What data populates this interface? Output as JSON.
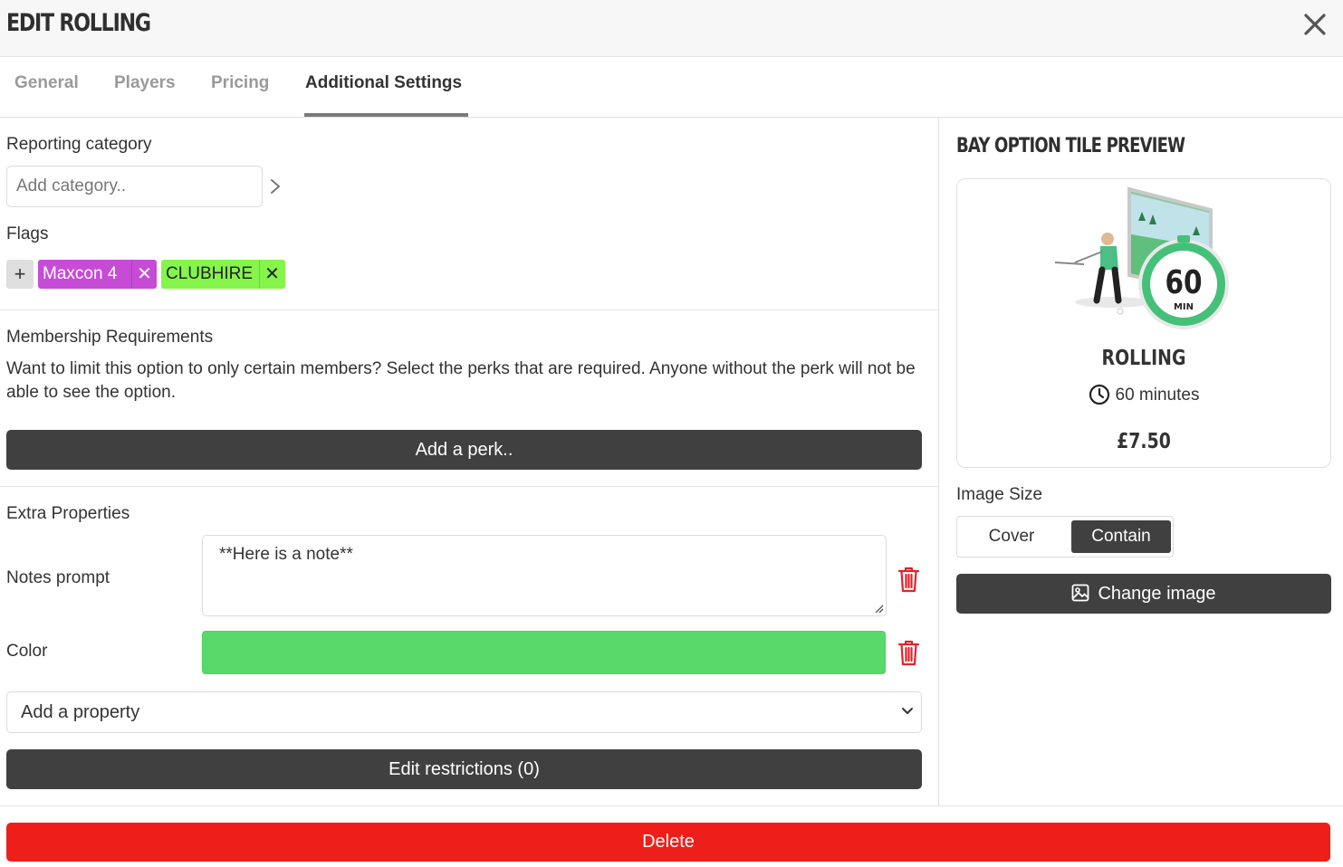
{
  "header": {
    "title": "EDIT ROLLING"
  },
  "tabs": [
    {
      "label": "General"
    },
    {
      "label": "Players"
    },
    {
      "label": "Pricing"
    },
    {
      "label": "Additional Settings"
    }
  ],
  "reporting": {
    "label": "Reporting category",
    "placeholder": "Add category.."
  },
  "flags": {
    "label": "Flags",
    "add": "+",
    "items": [
      {
        "label": "Maxcon 4",
        "color": "#c64cd6",
        "remove": "✕"
      },
      {
        "label": "CLUBHIRE",
        "color": "#85f54b",
        "remove": "✕"
      }
    ]
  },
  "membership": {
    "label": "Membership Requirements",
    "description": "Want to limit this option to only certain members? Select the perks that are required. Anyone without the perk will not be able to see the option.",
    "button": "Add a perk.."
  },
  "extra": {
    "label": "Extra Properties",
    "notes_label": "Notes prompt",
    "notes_value": "**Here is a note**",
    "color_label": "Color",
    "color_value": "#5ad96b",
    "add_property": "Add a property",
    "restrictions_button": "Edit restrictions (0)"
  },
  "delete_button": "Delete",
  "preview": {
    "title": "BAY OPTION TILE PREVIEW",
    "badge_number": "60",
    "badge_unit": "MIN",
    "name": "ROLLING",
    "duration": "60 minutes",
    "price": "£7.50",
    "image_size_label": "Image Size",
    "image_size_options": [
      "Cover",
      "Contain"
    ],
    "image_size_selected": "Contain",
    "change_image": "Change image"
  }
}
